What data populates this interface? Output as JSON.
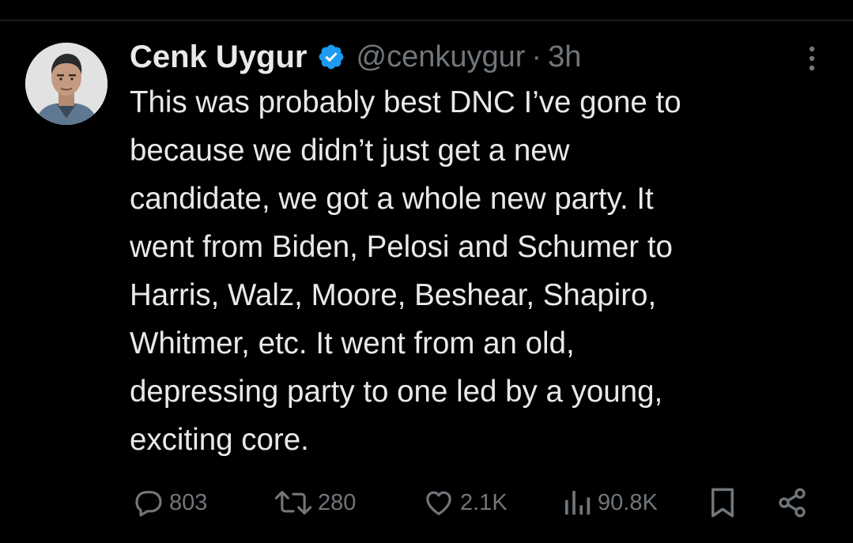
{
  "tweet": {
    "author": {
      "display_name": "Cenk Uygur",
      "handle": "@cenkuygur",
      "verified": true
    },
    "separator": "·",
    "time": "3h",
    "text_lines": [
      "This was probably best DNC I’ve gone to",
      "because we didn’t just get a new",
      "candidate, we got a whole new party. It",
      "went from Biden, Pelosi and Schumer to",
      "Harris, Walz, Moore, Beshear, Shapiro,",
      "Whitmer, etc. It went from an old,",
      "depressing party to one led by a young,",
      "exciting core."
    ],
    "stats": {
      "replies": "803",
      "reposts": "280",
      "likes": "2.1K",
      "views": "90.8K"
    }
  },
  "icons": {
    "verified": "verified-badge-icon",
    "more": "more-vertical-icon",
    "reply": "reply-icon",
    "repost": "repost-icon",
    "like": "heart-icon",
    "views": "views-bar-chart-icon",
    "bookmark": "bookmark-icon",
    "share": "share-icon"
  },
  "colors": {
    "background": "#000000",
    "text": "#e7e9ea",
    "secondary": "#71767b",
    "verified_blue": "#1d9bf0"
  }
}
